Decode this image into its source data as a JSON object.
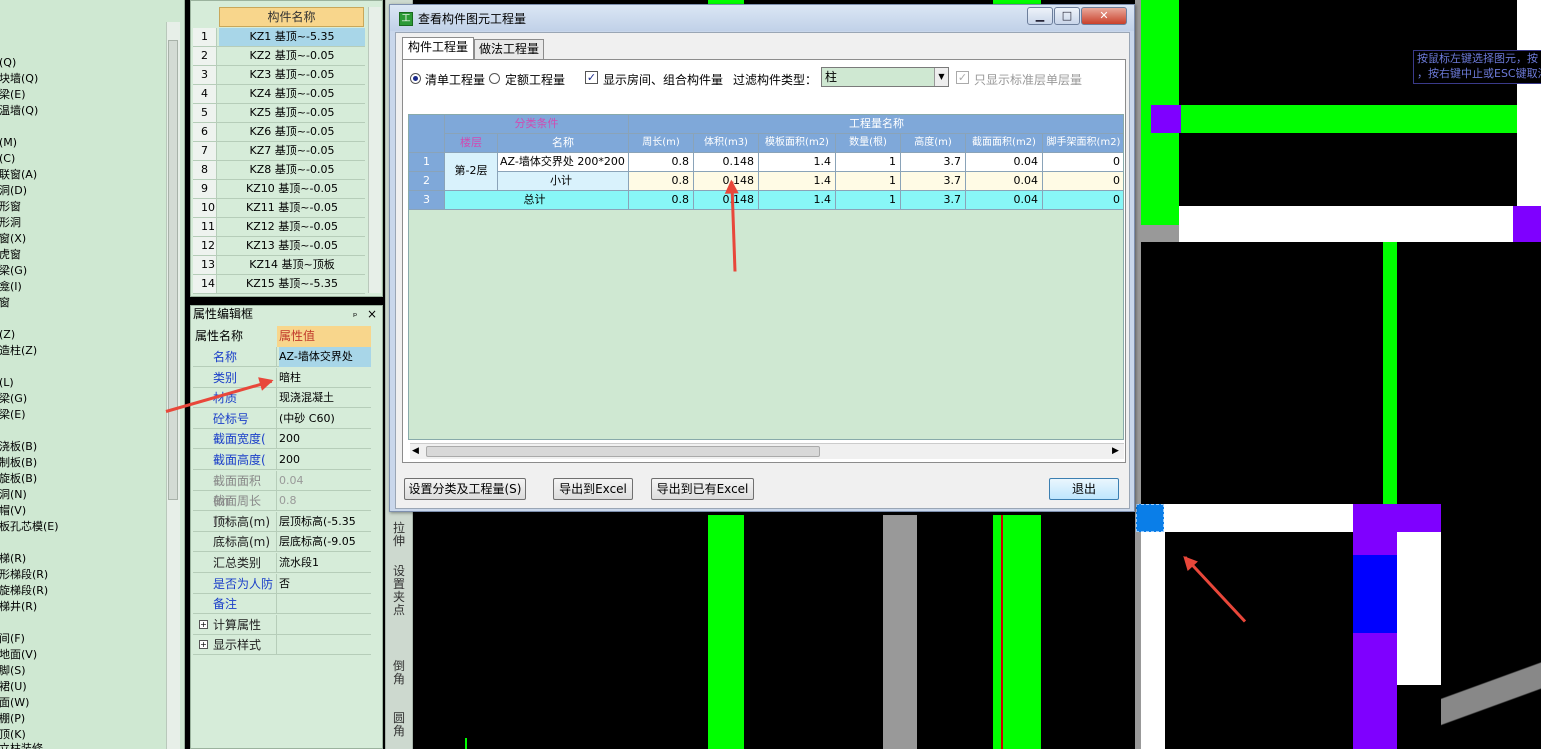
{
  "left_tree": {
    "items": [
      {
        "label": "墙(Q)"
      },
      {
        "label": "砌块墙(Q)"
      },
      {
        "label": "连梁(E)"
      },
      {
        "label": "保温墙(Q)"
      },
      {
        "label": "洞"
      },
      {
        "label": "门(M)"
      },
      {
        "label": "窗(C)"
      },
      {
        "label": "门联窗(A)"
      },
      {
        "label": "墙洞(D)"
      },
      {
        "label": "带形窗"
      },
      {
        "label": "带形洞"
      },
      {
        "label": "飘窗(X)"
      },
      {
        "label": "老虎窗"
      },
      {
        "label": "过梁(G)"
      },
      {
        "label": "壁龛(I)"
      },
      {
        "label": "天窗"
      },
      {
        "label": "柱(Z)"
      },
      {
        "label": "构造柱(Z)"
      },
      {
        "label": "梁(L)"
      },
      {
        "label": "圈梁(G)"
      },
      {
        "label": "连梁(E)"
      },
      {
        "label": "现浇板(B)"
      },
      {
        "label": "预制板(B)"
      },
      {
        "label": "螺旋板(B)"
      },
      {
        "label": "板洞(N)"
      },
      {
        "label": "柱帽(V)"
      },
      {
        "label": "楼板孔芯模(E)"
      },
      {
        "label": "楼梯(R)"
      },
      {
        "label": "直形梯段(R)"
      },
      {
        "label": "螺旋梯段(R)"
      },
      {
        "label": "楼梯井(R)"
      },
      {
        "label": "房间(F)"
      },
      {
        "label": "楼地面(V)"
      },
      {
        "label": "踢脚(S)"
      },
      {
        "label": "墙裙(U)"
      },
      {
        "label": "墙面(W)"
      },
      {
        "label": "天棚(P)"
      },
      {
        "label": "吊顶(K)"
      },
      {
        "label": "独立柱装修"
      }
    ]
  },
  "component_list": {
    "header": "构件名称",
    "rows": [
      {
        "num": "1",
        "name": "KZ1 基顶~-5.35"
      },
      {
        "num": "2",
        "name": "KZ2 基顶~-0.05"
      },
      {
        "num": "3",
        "name": "KZ3 基顶~-0.05"
      },
      {
        "num": "4",
        "name": "KZ4 基顶~-0.05"
      },
      {
        "num": "5",
        "name": "KZ5 基顶~-0.05"
      },
      {
        "num": "6",
        "name": "KZ6 基顶~-0.05"
      },
      {
        "num": "7",
        "name": "KZ7 基顶~-0.05"
      },
      {
        "num": "8",
        "name": "KZ8 基顶~-0.05"
      },
      {
        "num": "9",
        "name": "KZ10 基顶~-0.05"
      },
      {
        "num": "10",
        "name": "KZ11 基顶~-0.05"
      },
      {
        "num": "11",
        "name": "KZ12 基顶~-0.05"
      },
      {
        "num": "12",
        "name": "KZ13 基顶~-0.05"
      },
      {
        "num": "13",
        "name": "KZ14 基顶~顶板"
      },
      {
        "num": "14",
        "name": "KZ15 基顶~-5.35"
      }
    ]
  },
  "property_panel": {
    "title": "属性编辑框",
    "pin": "ₚ",
    "close": "×",
    "col_name": "属性名称",
    "col_value": "属性值",
    "rows": [
      {
        "name": "名称",
        "value": "AZ-墙体交界处"
      },
      {
        "name": "类别",
        "value": "暗柱"
      },
      {
        "name": "材质",
        "value": "现浇混凝土"
      },
      {
        "name": "砼标号",
        "value": "(中砂 C60)"
      },
      {
        "name": "截面宽度(",
        "value": "200"
      },
      {
        "name": "截面高度(",
        "value": "200"
      },
      {
        "name": "截面面积(m",
        "value": "0.04"
      },
      {
        "name": "截面周长(m",
        "value": "0.8"
      },
      {
        "name": "顶标高(m)",
        "value": "层顶标高(-5.35"
      },
      {
        "name": "底标高(m)",
        "value": "层底标高(-9.05"
      },
      {
        "name": "汇总类别",
        "value": "流水段1"
      },
      {
        "name": "是否为人防",
        "value": "否"
      },
      {
        "name": "备注",
        "value": ""
      },
      {
        "name": "计算属性",
        "value": ""
      },
      {
        "name": "显示样式",
        "value": ""
      }
    ]
  },
  "side_toolbar": {
    "items": [
      "拉伸",
      "设置夹点",
      "倒角",
      "圆角"
    ]
  },
  "dialog": {
    "title": "查看构件图元工程量",
    "tabs": [
      "构件工程量",
      "做法工程量"
    ],
    "options": {
      "radio_list": "清单工程量",
      "radio_quota": "定额工程量",
      "check_show_room": "显示房间、组合构件量",
      "filter_label": "过滤构件类型：",
      "filter_value": "柱",
      "check_standard_floor": "只显示标准层单层量"
    },
    "table": {
      "group_classify": "分类条件",
      "group_quantity": "工程量名称",
      "col_floor": "楼层",
      "col_name": "名称",
      "columns": [
        "周长(m)",
        "体积(m3)",
        "模板面积(m2)",
        "数量(根)",
        "高度(m)",
        "截面面积(m2)",
        "脚手架面积(m2)"
      ],
      "floor": "第-2层",
      "rows": [
        {
          "num": "1",
          "name": "AZ-墙体交界处 200*200",
          "values": [
            "0.8",
            "0.148",
            "1.4",
            "1",
            "3.7",
            "0.04",
            "0"
          ]
        },
        {
          "num": "2",
          "name": "小计",
          "values": [
            "0.8",
            "0.148",
            "1.4",
            "1",
            "3.7",
            "0.04",
            "0"
          ]
        },
        {
          "num": "3",
          "name": "总计",
          "values": [
            "0.8",
            "0.148",
            "1.4",
            "1",
            "3.7",
            "0.04",
            "0"
          ]
        }
      ]
    },
    "buttons": {
      "set_classify": "设置分类及工程量(S)",
      "export_excel": "导出到Excel",
      "export_existing": "导出到已有Excel",
      "exit": "退出"
    }
  },
  "tooltip": {
    "line1": "按鼠标左键选择图元，按",
    "line2": "，按右键中止或ESC键取消"
  },
  "colors": {
    "beam_green": "#00ff00",
    "column_purple": "#7f00ff",
    "selected_blue": "#0000ff",
    "panel_green": "#cfe8d2",
    "arrow_red": "#e8473a"
  }
}
